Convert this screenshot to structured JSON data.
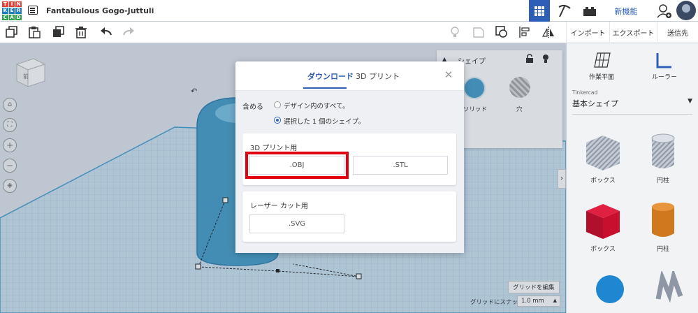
{
  "app": {
    "logo_letters": [
      "TIN",
      "KER",
      "CAD"
    ],
    "project_title": "Fantabulous Gogo-Juttuli",
    "new_features_label": "新機能"
  },
  "toolbar": {
    "import_label": "インポート",
    "export_label": "エクスポート",
    "send_to_label": "送信先"
  },
  "right_panel": {
    "workplane_label": "作業平面",
    "ruler_label": "ルーラー",
    "source_provider": "Tinkercad",
    "source_value": "基本シェイプ",
    "shapes": [
      {
        "label": "ボックス",
        "color": "#9aa6b8"
      },
      {
        "label": "円柱",
        "color": "#9aa6b8"
      },
      {
        "label": "ボックス",
        "color": "#c8102e"
      },
      {
        "label": "円柱",
        "color": "#d0781e"
      }
    ]
  },
  "inspector": {
    "shape_label": "シェイプ",
    "solid_label": "ソリッド",
    "hole_label": "穴"
  },
  "workplane": {
    "view_cube_label": "前",
    "edit_grid_label": "グリッドを編集",
    "snap_label": "グリッドにスナップ",
    "snap_value": "1.0 mm"
  },
  "dialog": {
    "tab_download": "ダウンロード",
    "tab_3d_print": "3D プリント",
    "include_label": "含める",
    "option_all": "デザイン内のすべて。",
    "option_selected": "選択した 1 個のシェイプ。",
    "print_section_title": "3D プリント用",
    "obj_label": ".OBJ",
    "stl_label": ".STL",
    "laser_section_title": "レーザー カット用",
    "svg_label": ".SVG"
  },
  "colors": {
    "accent": "#2d5fb8",
    "highlight": "#e0000f",
    "shape_blue": "#4a9fc9"
  }
}
